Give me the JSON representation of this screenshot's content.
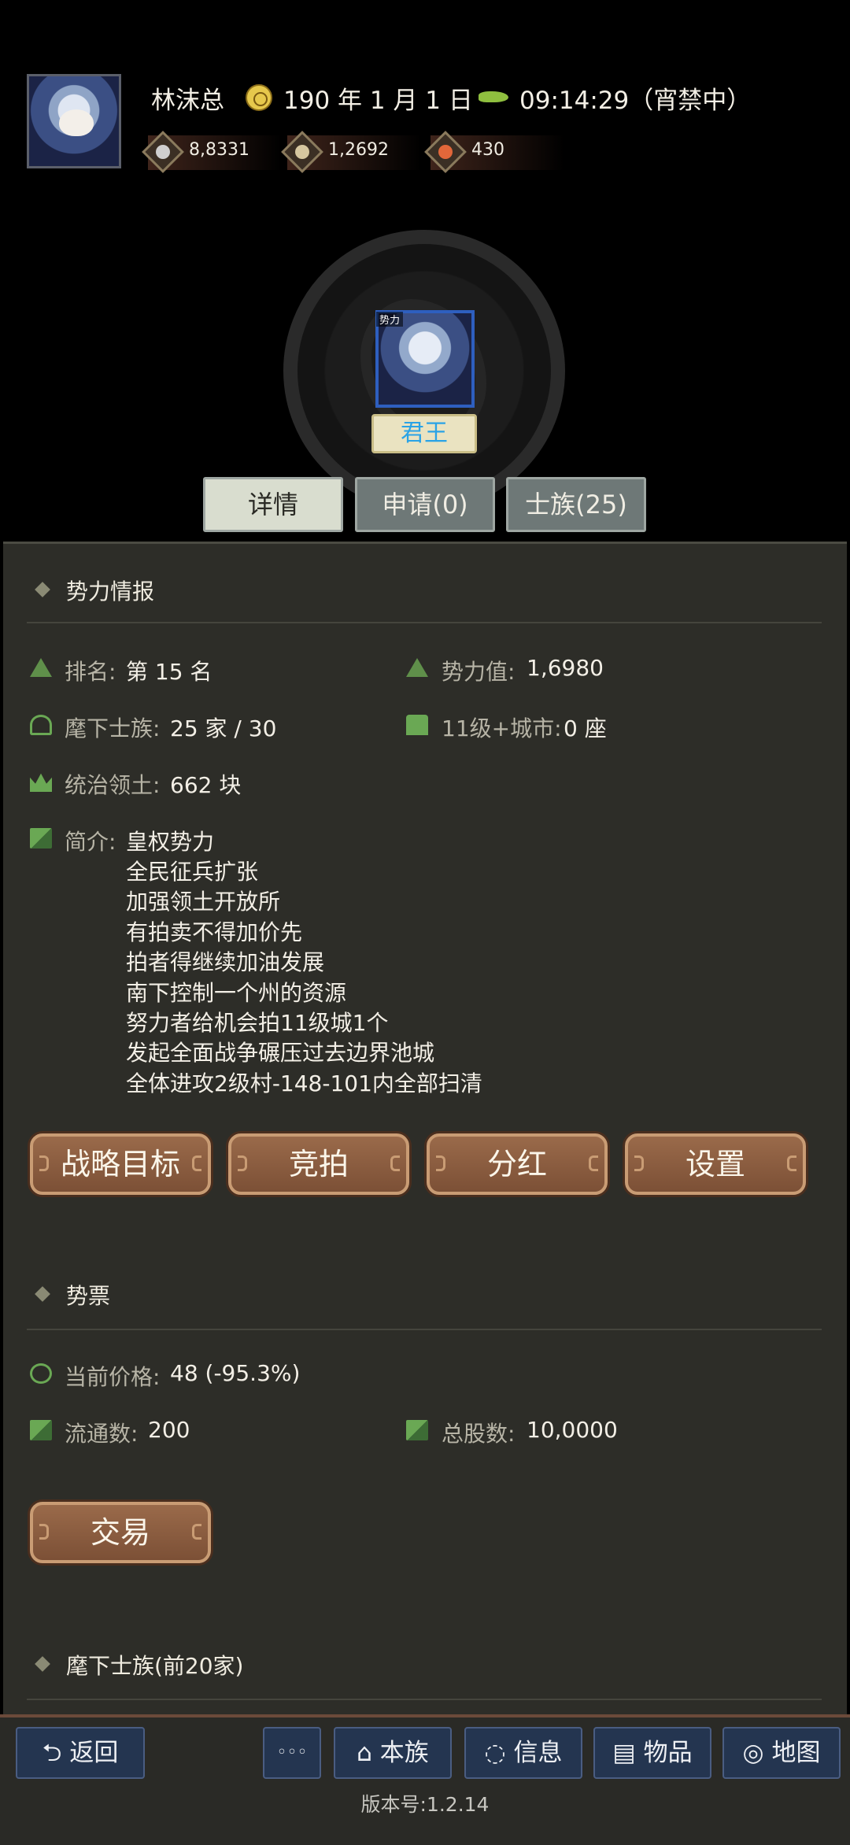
{
  "header": {
    "player_name": "林沫总",
    "date": "190 年 1 月 1 日",
    "time": "09:14:29（宵禁中）",
    "resources": [
      {
        "name": "silver",
        "value": "8,8331",
        "color": "#cfcfcf"
      },
      {
        "name": "grain",
        "value": "1,2692",
        "color": "#d6c7a0"
      },
      {
        "name": "gold",
        "value": "430",
        "color": "#e2673a"
      }
    ]
  },
  "faction": {
    "tag": "势力",
    "rank_title": "君王"
  },
  "tabs": {
    "detail": "详情",
    "apply": "申请(0)",
    "clan": "士族(25)"
  },
  "info": {
    "section_title": "势力情报",
    "rank_label": "排名:",
    "rank_value": "第 15 名",
    "power_label": "势力值:",
    "power_value": "1,6980",
    "clans_label": "麾下士族:",
    "clans_value": "25 家 / 30",
    "cities_label": "11级+城市:",
    "cities_value": "0 座",
    "territory_label": "统治领土:",
    "territory_value": "662 块",
    "intro_label": "简介:",
    "intro_lines": [
      "皇权势力",
      "全民征兵扩张",
      "加强领土开放所",
      "有拍卖不得加价先",
      "拍者得继续加油发展",
      "南下控制一个州的资源",
      "努力者给机会拍11级城1个",
      "发起全面战争碾压过去边界池城",
      "全体进攻2级村-148-101内全部扫清"
    ],
    "buttons": {
      "strategy": "战略目标",
      "auction": "竞拍",
      "dividend": "分红",
      "settings": "设置"
    }
  },
  "stock": {
    "section_title": "势票",
    "price_label": "当前价格:",
    "price_value": "48 (-95.3%)",
    "circulating_label": "流通数:",
    "circulating_value": "200",
    "total_label": "总股数:",
    "total_value": "10,0000",
    "trade_button": "交易"
  },
  "members": {
    "section_title": "麾下士族(前20家)"
  },
  "bottom_nav": {
    "back": "返回",
    "more": "◦◦◦",
    "clan": "本族",
    "message": "信息",
    "items": "物品",
    "map": "地图"
  },
  "version": "版本号:1.2.14",
  "colors": {
    "accent_green": "#6aa854",
    "button_brown": "#8a5c40",
    "nav_blue": "#243550",
    "rank_blue": "#2aa3e6"
  }
}
